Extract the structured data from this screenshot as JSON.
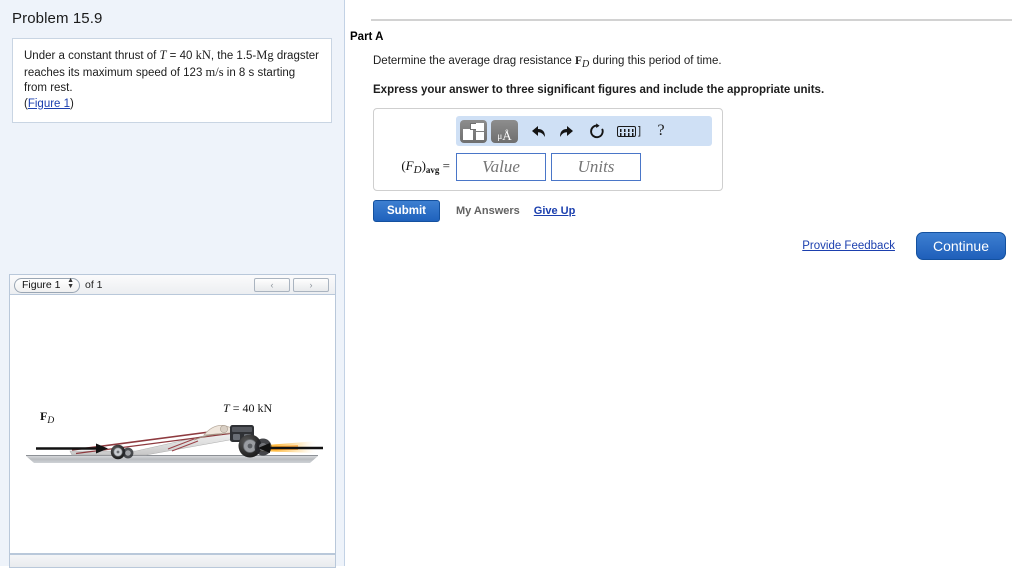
{
  "left": {
    "problem_title": "Problem 15.9",
    "statement": {
      "line1_a": "Under a constant thrust of ",
      "line1_T": "T",
      "line1_b": " = 40 ",
      "line1_kN": "kN",
      "line1_c": ", the 1.5-",
      "line1_Mg": "Mg",
      "line2_a": "dragster reaches its maximum speed of 123 ",
      "line2_ms": "m/s",
      "line2_b": " in 8 s",
      "line3": "starting from rest.",
      "figure_link": "Figure 1",
      "paren_open": "(",
      "paren_close": ")"
    },
    "figure_viewer": {
      "selected_figure": "Figure 1",
      "options": [
        "Figure 1"
      ],
      "of_label": "of 1",
      "prev_label": "‹",
      "next_label": "›"
    },
    "figure_content": {
      "force_label_bold": "F",
      "force_label_sub": "D",
      "thrust_label_T": "T",
      "thrust_label_rest": " = 40 kN"
    }
  },
  "right": {
    "part_label": "Part A",
    "question": {
      "prefix": "Determine the average drag resistance ",
      "symbol_bold": "F",
      "symbol_sub": "D",
      "suffix": " during this period of time."
    },
    "instruction": "Express your answer to three significant figures and include the appropriate units.",
    "answer": {
      "label_paren_open": "(",
      "label_F": "F",
      "label_sub_D": "D",
      "label_paren_close": ")",
      "label_sub_avg": "avg",
      "label_equals": "=",
      "value_placeholder": "Value",
      "value": "",
      "units_placeholder": "Units",
      "units": ""
    },
    "toolbar": {
      "template_icon": "template-icon",
      "units_icon": "μÅ",
      "units_icon_mu": "μ",
      "units_icon_A": "Å",
      "undo_icon": "undo-arrow",
      "redo_icon": "redo-arrow",
      "reset_icon": "reset-circular-arrow",
      "keyboard_icon": "keyboard",
      "keyboard_bracket": "]",
      "help_icon": "?"
    },
    "actions": {
      "submit": "Submit",
      "my_answers": "My Answers",
      "give_up": "Give Up",
      "provide_feedback": "Provide Feedback",
      "continue": "Continue"
    }
  },
  "colors": {
    "panel_bg": "#eef3fa",
    "accent_blue": "#1f62bd",
    "link_blue": "#1b3fae",
    "toolbar_blue": "#cfe0f5",
    "input_border": "#4a76c8"
  }
}
